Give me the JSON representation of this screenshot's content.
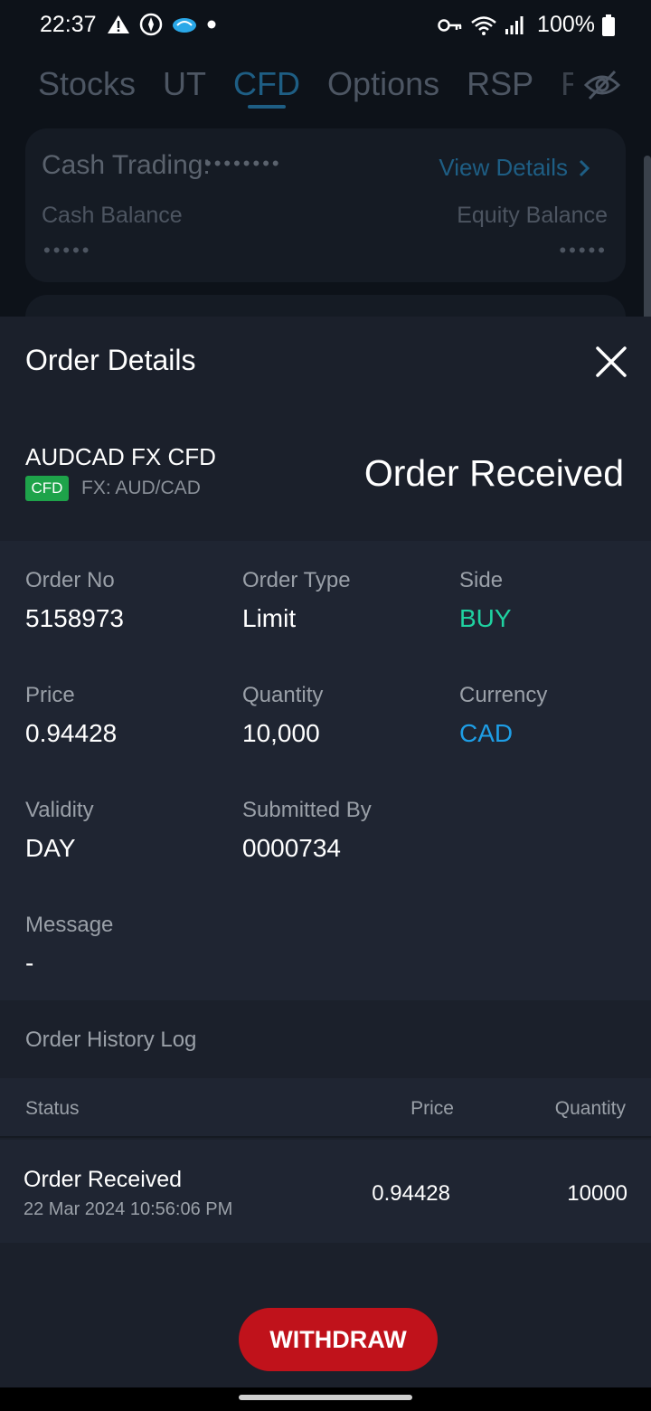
{
  "status_bar": {
    "time": "22:37",
    "battery": "100%",
    "icons": [
      "warning-icon",
      "compass-icon",
      "cloud-app-icon",
      "dot-icon",
      "key-icon",
      "wifi-icon",
      "signal-icon",
      "battery-icon"
    ]
  },
  "background_app": {
    "tabs": [
      "Stocks",
      "UT",
      "CFD",
      "Options",
      "RSP",
      "F"
    ],
    "active_tab": "CFD",
    "cash_card": {
      "title": "Cash Trading:",
      "masked_account": "••••••••",
      "view_details": "View Details",
      "cash_balance_label": "Cash Balance",
      "equity_balance_label": "Equity Balance",
      "cash_balance_value": "•••••",
      "equity_balance_value": "•••••"
    }
  },
  "order_details": {
    "title": "Order Details",
    "instrument": "AUDCAD FX CFD",
    "badge": "CFD",
    "pair": "FX: AUD/CAD",
    "status": "Order Received",
    "fields": {
      "order_no": {
        "label": "Order No",
        "value": "5158973"
      },
      "order_type": {
        "label": "Order Type",
        "value": "Limit"
      },
      "side": {
        "label": "Side",
        "value": "BUY"
      },
      "price": {
        "label": "Price",
        "value": "0.94428"
      },
      "quantity": {
        "label": "Quantity",
        "value": "10,000"
      },
      "currency": {
        "label": "Currency",
        "value": "CAD"
      },
      "validity": {
        "label": "Validity",
        "value": "DAY"
      },
      "submitted_by": {
        "label": "Submitted By",
        "value": "0000734"
      },
      "message": {
        "label": "Message",
        "value": "-"
      }
    },
    "history": {
      "label": "Order History Log",
      "columns": {
        "status": "Status",
        "price": "Price",
        "quantity": "Quantity"
      },
      "rows": [
        {
          "status": "Order Received",
          "time": "22 Mar 2024 10:56:06 PM",
          "price": "0.94428",
          "quantity": "10000"
        }
      ]
    },
    "withdraw_label": "WITHDRAW"
  },
  "colors": {
    "accent_blue": "#1e9ee6",
    "buy_green": "#1fd1a0",
    "withdraw_red": "#c0121b",
    "badge_green": "#1ea34a"
  }
}
